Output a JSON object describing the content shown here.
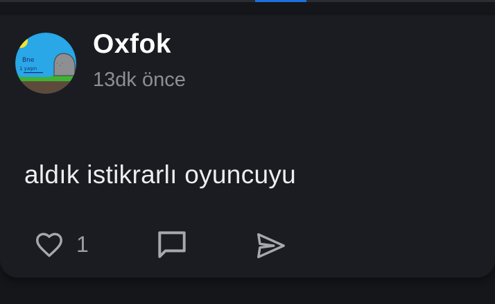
{
  "post": {
    "author": "Oxfok",
    "time_ago": "13dk önce",
    "body": "aldık istikrarlı oyuncuyu",
    "avatar_text": [
      "Bne",
      "1 yaşın"
    ]
  },
  "actions": {
    "like_count": "1"
  },
  "icons": {
    "like": "heart-outline-icon",
    "comment": "comment-bubble-icon",
    "share": "send-paper-plane-icon"
  },
  "colors": {
    "background": "#15161a",
    "card": "#1b1c21",
    "accent": "#1f6fe0",
    "text_primary": "#ffffff",
    "text_secondary": "#8d8f95",
    "icon": "#a6a8ad"
  }
}
